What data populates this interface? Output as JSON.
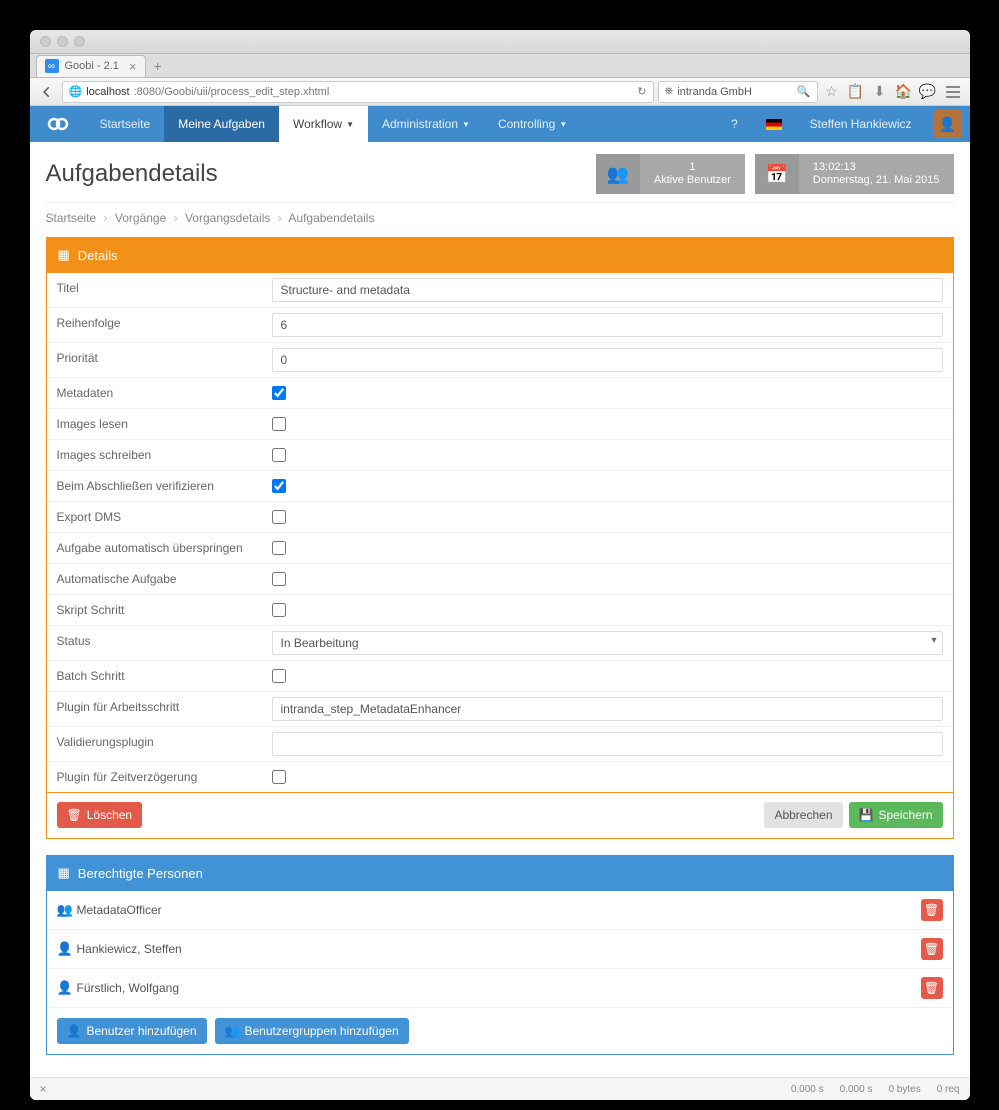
{
  "browser": {
    "tab_title": "Goobi - 2.1",
    "url_display_host": "localhost",
    "url_display_path": ":8080/Goobi/uii/process_edit_step.xhtml",
    "search_value": "intranda GmbH"
  },
  "nav": {
    "home": "Startseite",
    "tasks": "Meine Aufgaben",
    "workflow": "Workflow",
    "admin": "Administration",
    "control": "Controlling",
    "user": "Steffen Hankiewicz"
  },
  "header": {
    "title": "Aufgabendetails",
    "users_count": "1",
    "users_label": "Aktive Benutzer",
    "time": "13:02:13",
    "date": "Donnerstag, 21. Mai 2015"
  },
  "breadcrumb": {
    "home": "Startseite",
    "processes": "Vorgänge",
    "procdetails": "Vorgangsdetails",
    "current": "Aufgabendetails"
  },
  "panel_details": {
    "heading": "Details",
    "fields": {
      "title_label": "Titel",
      "title_value": "Structure- and metadata",
      "order_label": "Reihenfolge",
      "order_value": "6",
      "prio_label": "Priorität",
      "prio_value": "0",
      "metadata_label": "Metadaten",
      "images_read_label": "Images lesen",
      "images_write_label": "Images schreiben",
      "verify_label": "Beim Abschließen verifizieren",
      "export_label": "Export DMS",
      "auto_skip_label": "Aufgabe automatisch überspringen",
      "auto_task_label": "Automatische Aufgabe",
      "script_label": "Skript Schritt",
      "status_label": "Status",
      "status_value": "In Bearbeitung",
      "batch_label": "Batch Schritt",
      "plugin_step_label": "Plugin für Arbeitsschritt",
      "plugin_step_value": "intranda_step_MetadataEnhancer",
      "valid_plugin_label": "Validierungsplugin",
      "valid_plugin_value": "",
      "delay_plugin_label": "Plugin für Zeitverzögerung"
    },
    "buttons": {
      "delete": "Löschen",
      "cancel": "Abbrechen",
      "save": "Speichern"
    }
  },
  "panel_persons": {
    "heading": "Berechtigte Personen",
    "rows": [
      {
        "icon": "group",
        "name": "MetadataOfficer"
      },
      {
        "icon": "user",
        "name": "Hankiewicz, Steffen"
      },
      {
        "icon": "user",
        "name": "Fürstlich, Wolfgang"
      }
    ],
    "add_user": "Benutzer hinzufügen",
    "add_group": "Benutzergruppen hinzufügen"
  },
  "footer": {
    "s1": "0.000 s",
    "s2": "0.000 s",
    "s3": "0 bytes",
    "s4": "0 req"
  }
}
